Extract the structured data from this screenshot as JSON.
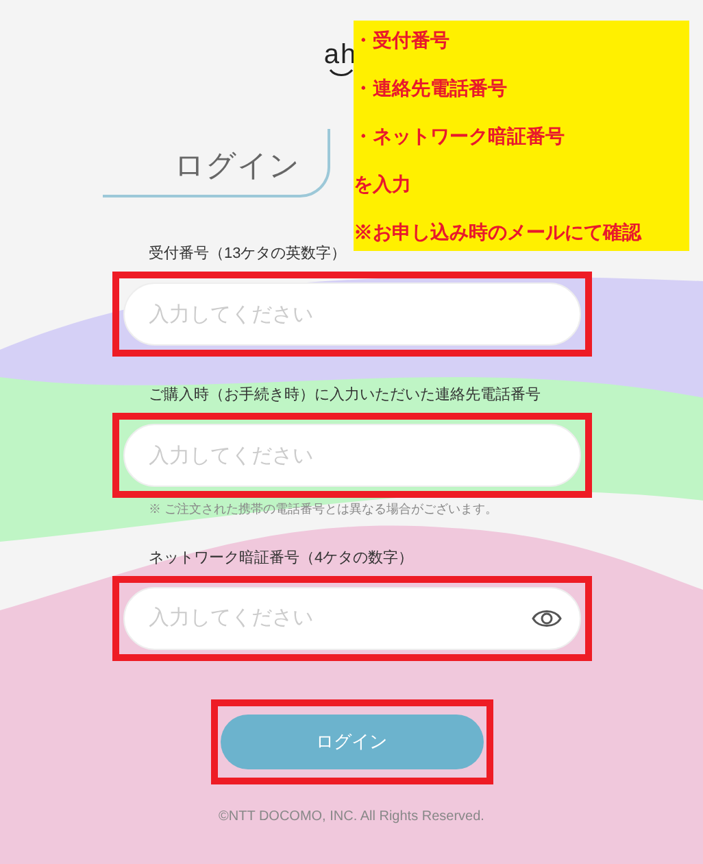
{
  "logo": {
    "text": "ah"
  },
  "title": "ログイン",
  "fields": [
    {
      "kind": "text",
      "label": "受付番号（13ケタの英数字）",
      "placeholder": "入力してください",
      "highlighted": true
    },
    {
      "kind": "text",
      "label": "ご購入時（お手続き時）に入力いただいた連絡先電話番号",
      "placeholder": "入力してください",
      "highlighted": true,
      "note": "※ ご注文された携帯の電話番号とは異なる場合がございます。"
    },
    {
      "kind": "password",
      "label": "ネットワーク暗証番号（4ケタの数字）",
      "placeholder": "入力してください",
      "highlighted": true
    }
  ],
  "login_button": {
    "label": "ログイン",
    "highlighted": true
  },
  "copyright": "©NTT DOCOMO, INC. All Rights Reserved.",
  "annotation": {
    "lines": [
      "・受付番号",
      "・連絡先電話番号",
      "・ネットワーク暗証番号",
      "を入力",
      "※お申し込み時のメールにて確認"
    ]
  }
}
